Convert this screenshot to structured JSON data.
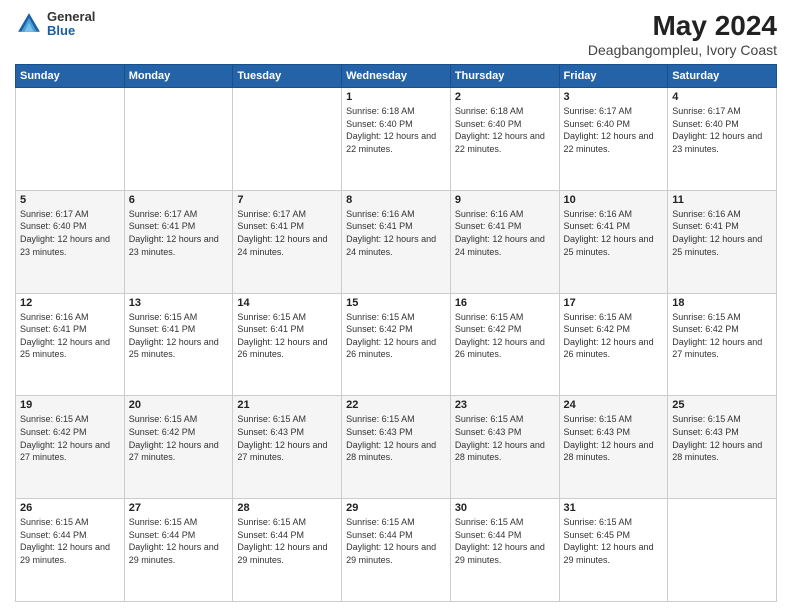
{
  "logo": {
    "general": "General",
    "blue": "Blue"
  },
  "title": "May 2024",
  "subtitle": "Deagbangompleu, Ivory Coast",
  "days_of_week": [
    "Sunday",
    "Monday",
    "Tuesday",
    "Wednesday",
    "Thursday",
    "Friday",
    "Saturday"
  ],
  "weeks": [
    [
      {
        "day": "",
        "sunrise": "",
        "sunset": "",
        "daylight": ""
      },
      {
        "day": "",
        "sunrise": "",
        "sunset": "",
        "daylight": ""
      },
      {
        "day": "",
        "sunrise": "",
        "sunset": "",
        "daylight": ""
      },
      {
        "day": "1",
        "sunrise": "Sunrise: 6:18 AM",
        "sunset": "Sunset: 6:40 PM",
        "daylight": "Daylight: 12 hours and 22 minutes."
      },
      {
        "day": "2",
        "sunrise": "Sunrise: 6:18 AM",
        "sunset": "Sunset: 6:40 PM",
        "daylight": "Daylight: 12 hours and 22 minutes."
      },
      {
        "day": "3",
        "sunrise": "Sunrise: 6:17 AM",
        "sunset": "Sunset: 6:40 PM",
        "daylight": "Daylight: 12 hours and 22 minutes."
      },
      {
        "day": "4",
        "sunrise": "Sunrise: 6:17 AM",
        "sunset": "Sunset: 6:40 PM",
        "daylight": "Daylight: 12 hours and 23 minutes."
      }
    ],
    [
      {
        "day": "5",
        "sunrise": "Sunrise: 6:17 AM",
        "sunset": "Sunset: 6:40 PM",
        "daylight": "Daylight: 12 hours and 23 minutes."
      },
      {
        "day": "6",
        "sunrise": "Sunrise: 6:17 AM",
        "sunset": "Sunset: 6:41 PM",
        "daylight": "Daylight: 12 hours and 23 minutes."
      },
      {
        "day": "7",
        "sunrise": "Sunrise: 6:17 AM",
        "sunset": "Sunset: 6:41 PM",
        "daylight": "Daylight: 12 hours and 24 minutes."
      },
      {
        "day": "8",
        "sunrise": "Sunrise: 6:16 AM",
        "sunset": "Sunset: 6:41 PM",
        "daylight": "Daylight: 12 hours and 24 minutes."
      },
      {
        "day": "9",
        "sunrise": "Sunrise: 6:16 AM",
        "sunset": "Sunset: 6:41 PM",
        "daylight": "Daylight: 12 hours and 24 minutes."
      },
      {
        "day": "10",
        "sunrise": "Sunrise: 6:16 AM",
        "sunset": "Sunset: 6:41 PM",
        "daylight": "Daylight: 12 hours and 25 minutes."
      },
      {
        "day": "11",
        "sunrise": "Sunrise: 6:16 AM",
        "sunset": "Sunset: 6:41 PM",
        "daylight": "Daylight: 12 hours and 25 minutes."
      }
    ],
    [
      {
        "day": "12",
        "sunrise": "Sunrise: 6:16 AM",
        "sunset": "Sunset: 6:41 PM",
        "daylight": "Daylight: 12 hours and 25 minutes."
      },
      {
        "day": "13",
        "sunrise": "Sunrise: 6:15 AM",
        "sunset": "Sunset: 6:41 PM",
        "daylight": "Daylight: 12 hours and 25 minutes."
      },
      {
        "day": "14",
        "sunrise": "Sunrise: 6:15 AM",
        "sunset": "Sunset: 6:41 PM",
        "daylight": "Daylight: 12 hours and 26 minutes."
      },
      {
        "day": "15",
        "sunrise": "Sunrise: 6:15 AM",
        "sunset": "Sunset: 6:42 PM",
        "daylight": "Daylight: 12 hours and 26 minutes."
      },
      {
        "day": "16",
        "sunrise": "Sunrise: 6:15 AM",
        "sunset": "Sunset: 6:42 PM",
        "daylight": "Daylight: 12 hours and 26 minutes."
      },
      {
        "day": "17",
        "sunrise": "Sunrise: 6:15 AM",
        "sunset": "Sunset: 6:42 PM",
        "daylight": "Daylight: 12 hours and 26 minutes."
      },
      {
        "day": "18",
        "sunrise": "Sunrise: 6:15 AM",
        "sunset": "Sunset: 6:42 PM",
        "daylight": "Daylight: 12 hours and 27 minutes."
      }
    ],
    [
      {
        "day": "19",
        "sunrise": "Sunrise: 6:15 AM",
        "sunset": "Sunset: 6:42 PM",
        "daylight": "Daylight: 12 hours and 27 minutes."
      },
      {
        "day": "20",
        "sunrise": "Sunrise: 6:15 AM",
        "sunset": "Sunset: 6:42 PM",
        "daylight": "Daylight: 12 hours and 27 minutes."
      },
      {
        "day": "21",
        "sunrise": "Sunrise: 6:15 AM",
        "sunset": "Sunset: 6:43 PM",
        "daylight": "Daylight: 12 hours and 27 minutes."
      },
      {
        "day": "22",
        "sunrise": "Sunrise: 6:15 AM",
        "sunset": "Sunset: 6:43 PM",
        "daylight": "Daylight: 12 hours and 28 minutes."
      },
      {
        "day": "23",
        "sunrise": "Sunrise: 6:15 AM",
        "sunset": "Sunset: 6:43 PM",
        "daylight": "Daylight: 12 hours and 28 minutes."
      },
      {
        "day": "24",
        "sunrise": "Sunrise: 6:15 AM",
        "sunset": "Sunset: 6:43 PM",
        "daylight": "Daylight: 12 hours and 28 minutes."
      },
      {
        "day": "25",
        "sunrise": "Sunrise: 6:15 AM",
        "sunset": "Sunset: 6:43 PM",
        "daylight": "Daylight: 12 hours and 28 minutes."
      }
    ],
    [
      {
        "day": "26",
        "sunrise": "Sunrise: 6:15 AM",
        "sunset": "Sunset: 6:44 PM",
        "daylight": "Daylight: 12 hours and 29 minutes."
      },
      {
        "day": "27",
        "sunrise": "Sunrise: 6:15 AM",
        "sunset": "Sunset: 6:44 PM",
        "daylight": "Daylight: 12 hours and 29 minutes."
      },
      {
        "day": "28",
        "sunrise": "Sunrise: 6:15 AM",
        "sunset": "Sunset: 6:44 PM",
        "daylight": "Daylight: 12 hours and 29 minutes."
      },
      {
        "day": "29",
        "sunrise": "Sunrise: 6:15 AM",
        "sunset": "Sunset: 6:44 PM",
        "daylight": "Daylight: 12 hours and 29 minutes."
      },
      {
        "day": "30",
        "sunrise": "Sunrise: 6:15 AM",
        "sunset": "Sunset: 6:44 PM",
        "daylight": "Daylight: 12 hours and 29 minutes."
      },
      {
        "day": "31",
        "sunrise": "Sunrise: 6:15 AM",
        "sunset": "Sunset: 6:45 PM",
        "daylight": "Daylight: 12 hours and 29 minutes."
      },
      {
        "day": "",
        "sunrise": "",
        "sunset": "",
        "daylight": ""
      }
    ]
  ]
}
